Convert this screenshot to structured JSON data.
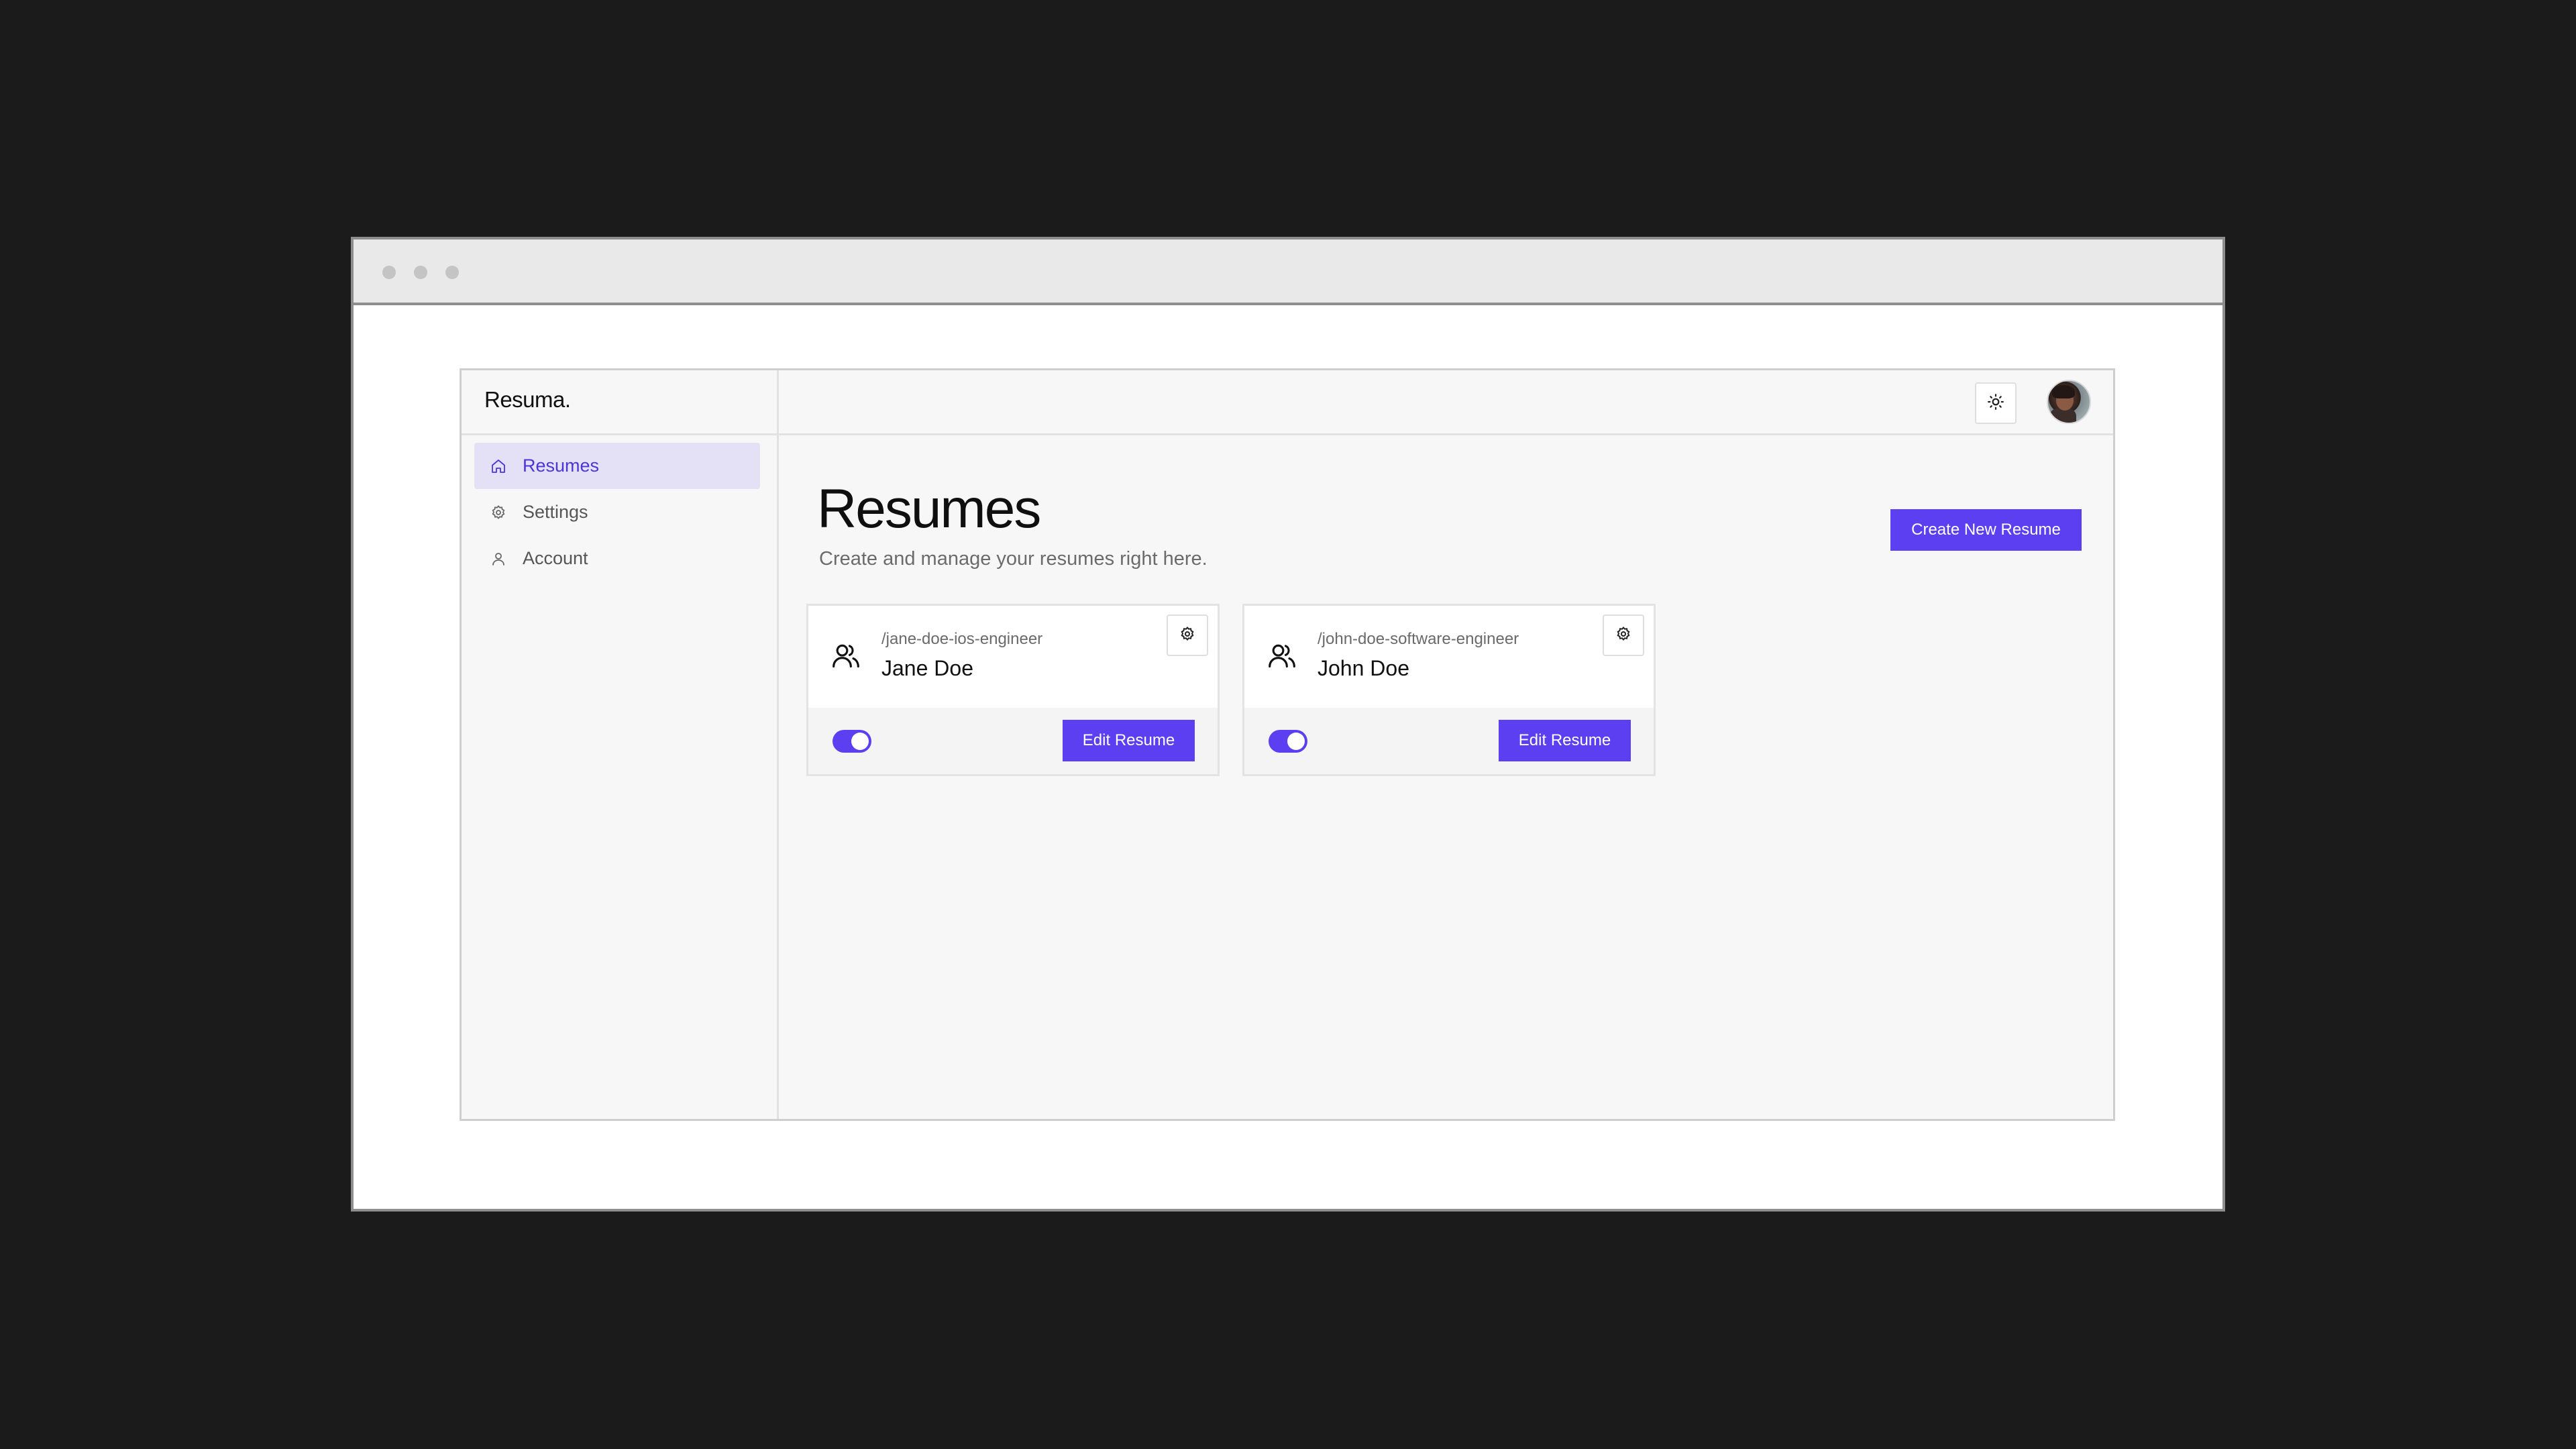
{
  "app": {
    "logo": "Resuma."
  },
  "sidebar": {
    "items": [
      {
        "label": "Resumes",
        "icon": "home-icon",
        "active": true
      },
      {
        "label": "Settings",
        "icon": "gear-icon",
        "active": false
      },
      {
        "label": "Account",
        "icon": "user-icon",
        "active": false
      }
    ]
  },
  "header": {
    "theme_icon": "sun-icon",
    "avatar": "user-avatar"
  },
  "main": {
    "title": "Resumes",
    "subtitle": "Create and manage your resumes right here.",
    "create_label": "Create New Resume"
  },
  "cards": [
    {
      "slug": "/jane-doe-ios-engineer",
      "name": "Jane Doe",
      "published": true,
      "edit_label": "Edit Resume"
    },
    {
      "slug": "/john-doe-software-engineer",
      "name": "John Doe",
      "published": true,
      "edit_label": "Edit Resume"
    }
  ],
  "colors": {
    "accent": "#5b3ff0",
    "accent_bg": "#e4e1f7",
    "background": "#1b1b1b"
  }
}
